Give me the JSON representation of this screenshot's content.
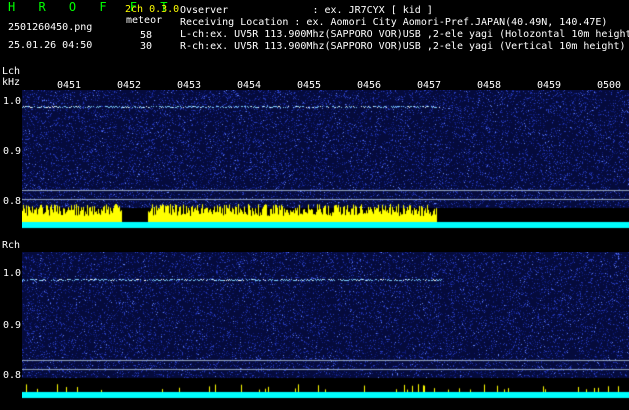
{
  "header": {
    "title": "H R O F F T",
    "filename": "2501260450.png",
    "datetime": "25.01.26 04:50",
    "mode": "2ch 0.3.0",
    "meteor_label": "meteor",
    "count_l": "58",
    "count_r": "30",
    "observer": "Ovserver              : ex. JR7CYX [ kid ]",
    "location": "Receiving Location : ex. Aomori City Aomori-Pref.JAPAN(40.49N, 140.47E)",
    "lch_info": "L-ch:ex. UV5R 113.900Mhz(SAPPORO VOR)USB ,2-ele yagi (Holozontal 10m height)",
    "rch_info": "R-ch:ex. UV5R 113.900Mhz(SAPPORO VOR)USB ,2-ele yagi (Vertical 10m height)"
  },
  "lch": {
    "label": "Lch",
    "unit": "kHz",
    "yticks": [
      "1.0",
      "0.9",
      "0.8"
    ]
  },
  "rch": {
    "label": "Rch",
    "yticks": [
      "1.0",
      "0.9",
      "0.8"
    ]
  },
  "time_ticks": [
    "0451",
    "0452",
    "0453",
    "0454",
    "0455",
    "0456",
    "0457",
    "0458",
    "0459",
    "0500"
  ],
  "colors": {
    "bg": "#000000",
    "noise": "#1a2a8a",
    "signal_l": "#ffff00",
    "signal_r": "#ffff00",
    "baseline": "#00ffff",
    "text": "#ffffff",
    "title": "#00ff00"
  }
}
